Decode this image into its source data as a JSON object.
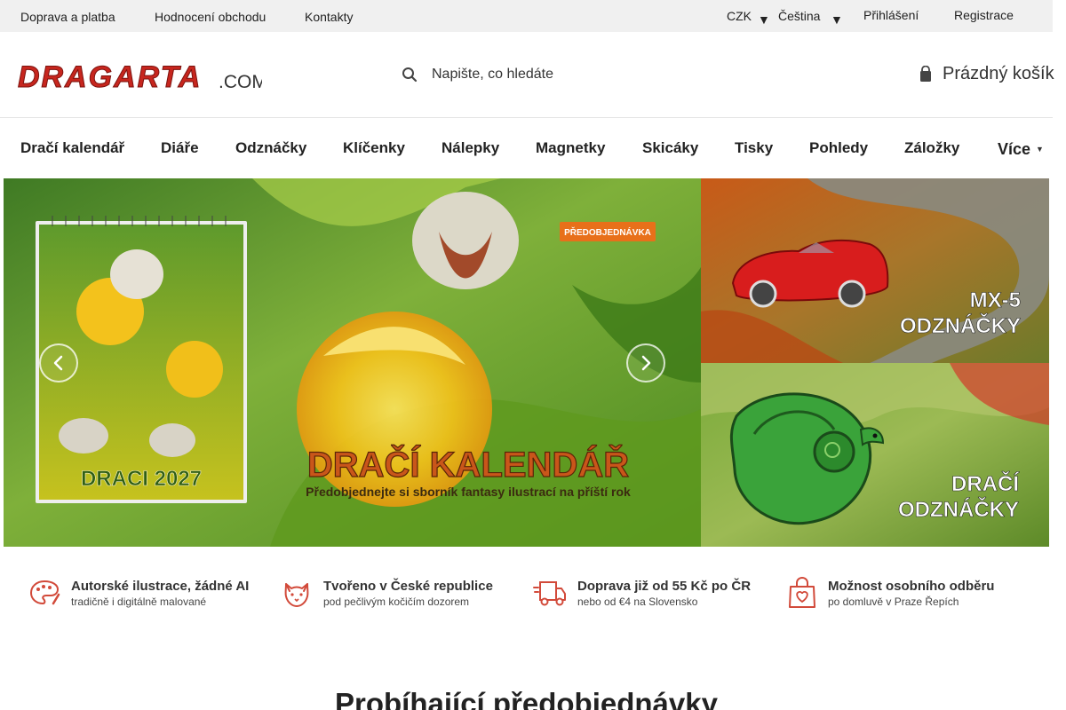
{
  "topbar": {
    "links": [
      "Doprava a platba",
      "Hodnocení obchodu",
      "Kontakty"
    ],
    "currency": "CZK",
    "language": "Čeština",
    "login": "Přihlášení",
    "register": "Registrace"
  },
  "header": {
    "logo_text": "DRAGARTA",
    "logo_suffix": ".COM",
    "search_placeholder": "Napište, co hledáte",
    "cart_label": "Prázdný košík"
  },
  "nav": [
    "Dračí kalendář",
    "Diáře",
    "Odznáčky",
    "Klíčenky",
    "Nálepky",
    "Magnetky",
    "Skicáky",
    "Tisky",
    "Pohledy",
    "Záložky",
    "Více"
  ],
  "banners": {
    "main": {
      "badge": "PŘEDOBJEDNÁVKA",
      "title": "DRAČÍ KALENDÁŘ",
      "subtitle": "Předobjednejte si sborník fantasy ilustrací na příští rok",
      "calendar_title": "DRACI 2027"
    },
    "side_top": {
      "line1": "MX-5",
      "line2": "ODZNÁČKY"
    },
    "side_bottom": {
      "line1": "DRAČÍ",
      "line2": "ODZNÁČKY"
    }
  },
  "benefits": [
    {
      "title": "Autorské ilustrace, žádné AI",
      "sub": "tradičně i digitálně malované",
      "icon": "palette-icon"
    },
    {
      "title": "Tvořeno v České republice",
      "sub": "pod pečlivým kočičím dozorem",
      "icon": "cat-icon"
    },
    {
      "title": "Doprava již od 55 Kč po ČR",
      "sub": "nebo od €4 na Slovensko",
      "icon": "delivery-truck-icon"
    },
    {
      "title": "Možnost osobního odběru",
      "sub": "po domluvě v Praze Řepích",
      "icon": "shopping-bag-heart-icon"
    }
  ],
  "section_title": "Probíhající předobjednávky",
  "colors": {
    "brand_red": "#c7261e",
    "accent_orange": "#e8701a",
    "icon_red": "#d24a3a"
  }
}
